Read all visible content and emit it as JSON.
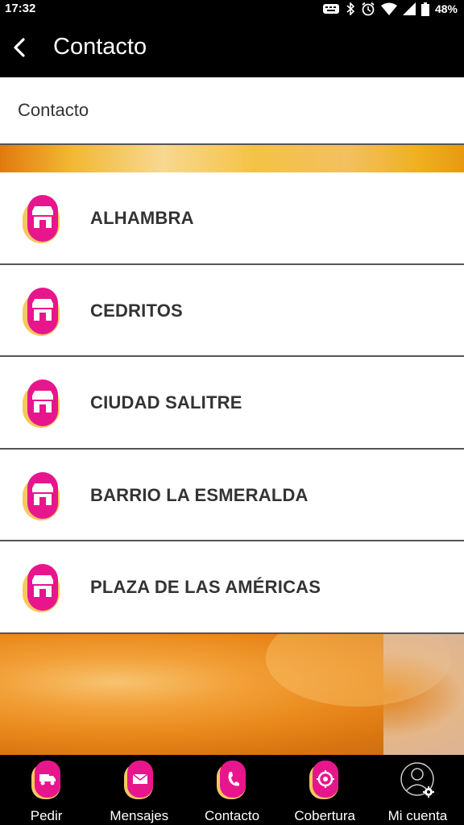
{
  "status_bar": {
    "time": "17:32",
    "battery": "48%"
  },
  "app_bar": {
    "title": "Contacto",
    "back_icon": "chevron-left-icon"
  },
  "section": {
    "title": "Contacto"
  },
  "locations": [
    {
      "name": "ALHAMBRA",
      "icon": "store-icon"
    },
    {
      "name": "CEDRITOS",
      "icon": "store-icon"
    },
    {
      "name": "CIUDAD SALITRE",
      "icon": "store-icon"
    },
    {
      "name": "BARRIO LA ESMERALDA",
      "icon": "store-icon"
    },
    {
      "name": "PLAZA DE LAS AMÉRICAS",
      "icon": "store-icon"
    }
  ],
  "bottom_nav": [
    {
      "label": "Pedir",
      "icon": "delivery-truck-icon"
    },
    {
      "label": "Mensajes",
      "icon": "envelope-icon"
    },
    {
      "label": "Contacto",
      "icon": "phone-icon"
    },
    {
      "label": "Cobertura",
      "icon": "coverage-icon"
    },
    {
      "label": "Mi cuenta",
      "icon": "account-settings-icon"
    }
  ],
  "colors": {
    "accent_pink": "#e8168c",
    "accent_yellow": "#f6c85f",
    "bar_background": "#000000",
    "divider": "#555555"
  }
}
